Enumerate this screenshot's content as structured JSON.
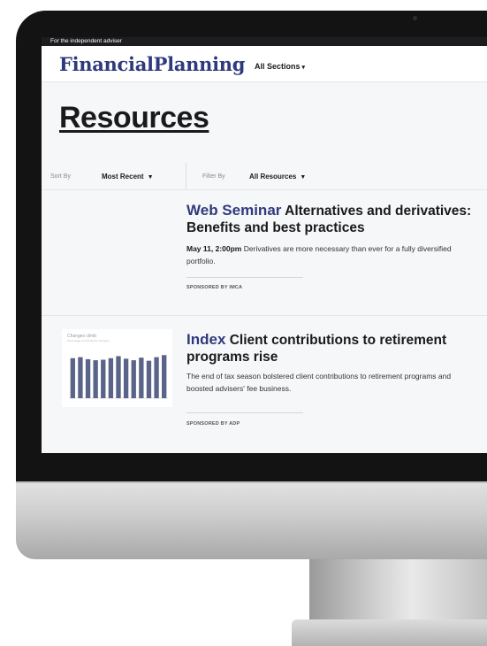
{
  "site": {
    "tagline": "For the independent adviser",
    "logo": "FinancialPlanning",
    "nav_label": "All Sections",
    "nav_chevron": "▾"
  },
  "page": {
    "title": "Resources"
  },
  "filters": {
    "sort_label": "Sort By",
    "sort_value": "Most Recent",
    "filter_label": "Filter By",
    "filter_value": "All Resources",
    "arrow": "▼"
  },
  "articles": [
    {
      "type": "Web Seminar",
      "title": "Alternatives and derivatives: Benefits and best practices",
      "date": "May 11, 2:00pm",
      "description": "Derivatives are more necessary than ever for a fully diversified portfolio.",
      "sponsor": "SPONSORED BY IMCA"
    },
    {
      "type": "Index",
      "title": "Client contributions to retirement programs rise",
      "description": "The end of tax season bolstered client contributions to retirement programs and boosted advisers' fee business.",
      "sponsor": "SPONSORED BY ADP",
      "thumbnail": {
        "title": "Changes climb",
        "subtitle": "Percentage of contribution changes...",
        "chart_data": {
          "type": "bar",
          "values": [
            78,
            80,
            76,
            74,
            75,
            78,
            82,
            77,
            74,
            79,
            73,
            80,
            84
          ],
          "ylim": [
            0,
            100
          ],
          "color": "#5a6488"
        }
      }
    }
  ],
  "colors": {
    "brand": "#2f3a7c",
    "text": "#1a1a1a",
    "screen_bg": "#f6f7f9",
    "bezel": "#131313"
  }
}
